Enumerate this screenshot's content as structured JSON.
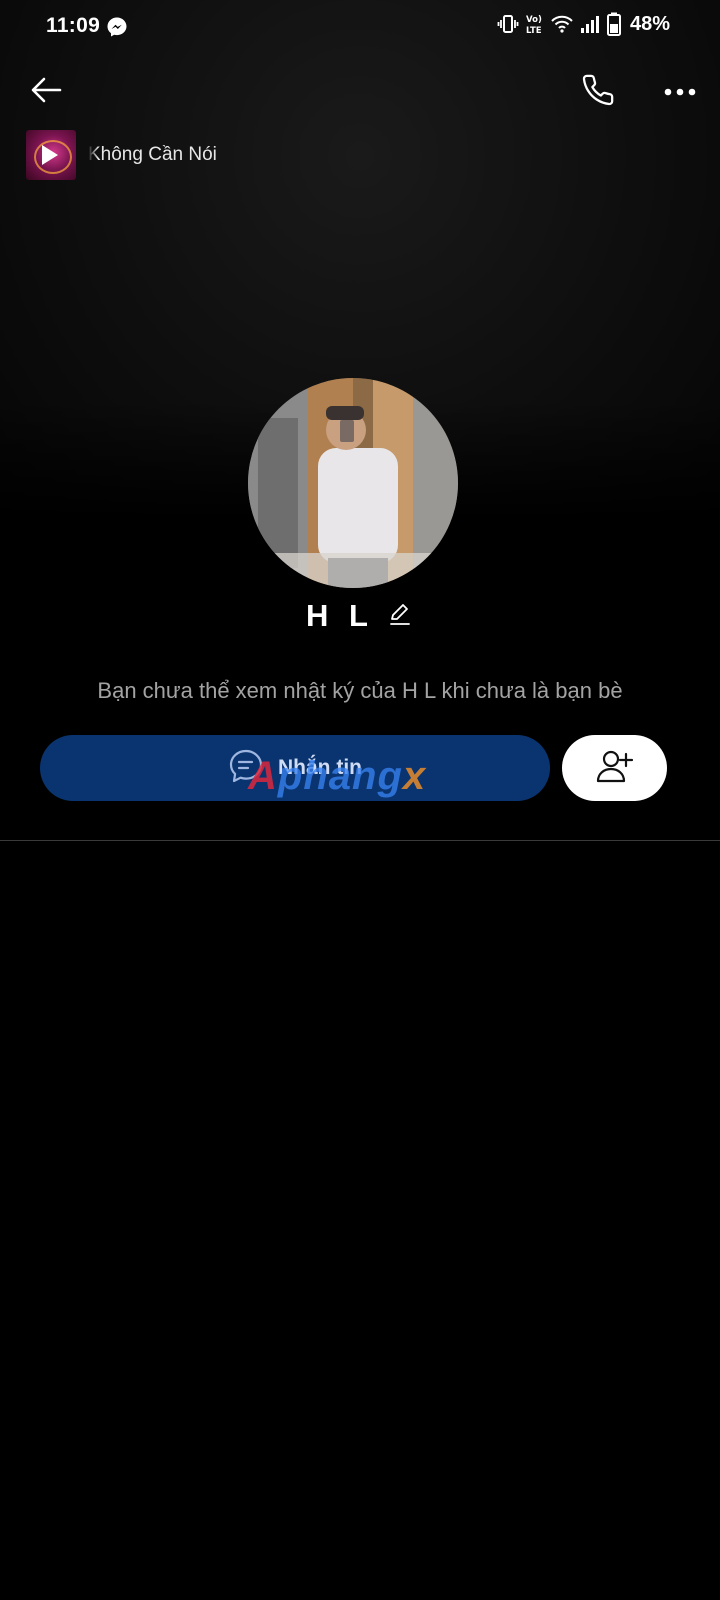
{
  "status_bar": {
    "time": "11:09",
    "battery": "48%",
    "icons": [
      "messenger-icon",
      "vibrate-icon",
      "volte-icon",
      "wifi-icon",
      "signal-icon",
      "battery-icon"
    ]
  },
  "header": {
    "back_icon": "arrow-left-icon",
    "call_icon": "phone-icon",
    "more_icon": "more-horizontal-icon"
  },
  "music": {
    "song_title": "Không Cần Nói",
    "play_icon": "play-icon"
  },
  "profile": {
    "name": "H L",
    "edit_icon": "pencil-icon",
    "notice": "Bạn chưa thể xem nhật ký của H L khi chưa là bạn bè"
  },
  "actions": {
    "message_label": "Nhắn tin",
    "message_icon": "chat-bubble-icon",
    "add_friend_icon": "add-user-icon"
  },
  "watermark": {
    "part1": "A",
    "part2": "phang",
    "part3": "x"
  },
  "colors": {
    "background": "#000000",
    "message_button": "#0a3470",
    "add_friend_button": "#ffffff",
    "notice_text": "#a3a3a3"
  }
}
